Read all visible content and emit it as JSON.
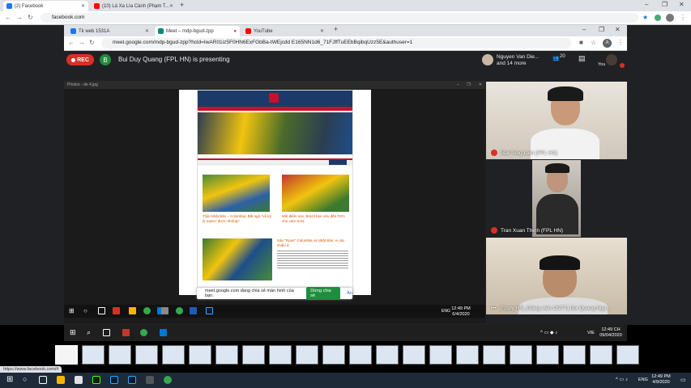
{
  "outer_browser": {
    "tabs": [
      {
        "label": "(2) Facebook",
        "color": "#1877f2"
      },
      {
        "label": "(10) Lá Xa Lìa Cành (Phạm T...",
        "color": "#ff0000"
      }
    ],
    "new_tab": "+",
    "url": "facebook.com"
  },
  "inner_browser": {
    "tabs": [
      {
        "label": "Tk web 1531A",
        "color": "#1877f2"
      },
      {
        "label": "Meet – mdp-bgud-zpp",
        "color": "#00897b"
      },
      {
        "label": "YouTube",
        "color": "#ff0000"
      }
    ],
    "new_tab": "+",
    "url": "meet.google.com/mdp-bgud-zpp?hcld=IwAR01iz5F0HN6ExFGbBa-tWEjcdd E165NN1d6_71FJffTuEEbBqibqUzz5E&authuser=1"
  },
  "meet": {
    "rec_label": "REC",
    "presenter_initial": "B",
    "presenting_text": "Bui Duy Quang (FPL HN) is presenting",
    "participants_name": "Nguyen Van Die...",
    "participants_more": "and 14 more",
    "participant_count": "20",
    "you_label": "You",
    "tiles": [
      {
        "name": "Mai Tung Lam (FPL HN)",
        "muted": true
      },
      {
        "name": "Tran Xuan Thinh (FPL HN)",
        "muted": true
      },
      {
        "name": "(Fpoly HN_Giảng viên CNTT) Bùi Quang Ngọ...",
        "muted": false
      }
    ]
  },
  "presentation": {
    "window_title": "Photos - de 4.jpg",
    "article1": "Trận Nhật Bản – Colombia: Bất ngờ \"vô kỷ lụ mario\" đươc không?",
    "article2": "Một điểm son, Brazil bùn cứu đến FIFA cho cam SAN",
    "article3": "Xảo \"Rune\" Colombia vs Nhật Bản: Ai xta chiếu ả",
    "share_text": "meet.google.com đang chia sẻ màn hình của bạn.",
    "stop_share": "Dừng chia sẻ",
    "hide": "Ẩn",
    "taskbar_time": "12:49 PM",
    "taskbar_date": "6/4/2020",
    "lang": "ENG"
  },
  "desktop1": {
    "time": "12:49 CH",
    "date": "09/04/2020",
    "lang": "VIE"
  },
  "status_link": "https://www.facebook.com/#",
  "desktop2": {
    "time": "12:49 PM",
    "date": "4/9/2020",
    "lang": "ENG"
  }
}
